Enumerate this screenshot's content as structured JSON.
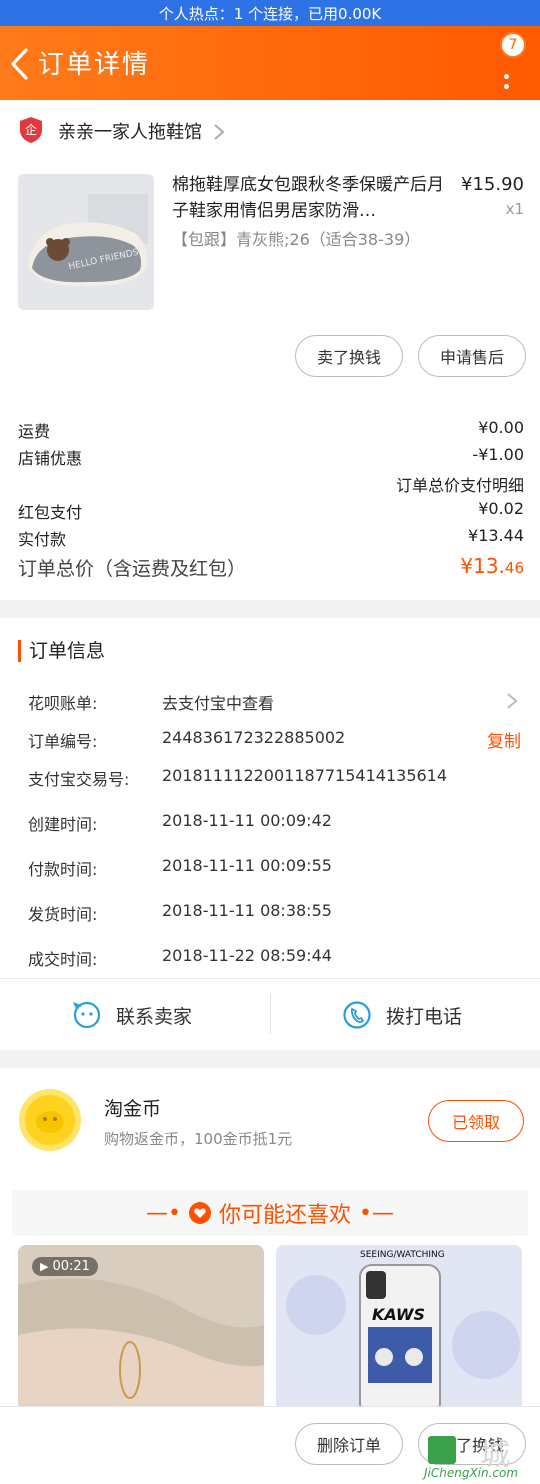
{
  "status_bar": {
    "hotspot_text": "个人热点：1 个连接，已用0.00K"
  },
  "header": {
    "title": "订单详情",
    "badge_count": "7"
  },
  "shop": {
    "name": "亲亲一家人拖鞋馆"
  },
  "product": {
    "title": "棉拖鞋厚底女包跟秋冬季保暖产后月子鞋家用情侣男居家防滑…",
    "sku": "【包跟】青灰熊;26（适合38-39）",
    "price": "¥15.90",
    "qty": "x1",
    "image_text": "HELLO FRIENDS"
  },
  "actions": {
    "sell_label": "卖了换钱",
    "after_sale_label": "申请售后"
  },
  "fees": {
    "shipping_label": "运费",
    "shipping_value": "¥0.00",
    "discount_label": "店铺优惠",
    "discount_value": "-¥1.00",
    "detail_link": "订单总价支付明细",
    "redpacket_label": "红包支付",
    "redpacket_value": "¥0.02",
    "paid_label": "实付款",
    "paid_value": "¥13.44",
    "total_label": "订单总价（含运费及红包）",
    "total_big": "¥13.",
    "total_small": "46"
  },
  "order_info": {
    "title": "订单信息",
    "huabei_label": "花呗账单:",
    "huabei_value": "去支付宝中查看",
    "order_no_label": "订单编号:",
    "order_no_value": "244836172322885002",
    "copy_label": "复制",
    "alipay_label": "支付宝交易号:",
    "alipay_value": "2018111122001187715414135614",
    "created_label": "创建时间:",
    "created_value": "2018-11-11 00:09:42",
    "paid_label": "付款时间:",
    "paid_value": "2018-11-11 00:09:55",
    "shipped_label": "发货时间:",
    "shipped_value": "2018-11-11 08:38:55",
    "done_label": "成交时间:",
    "done_value": "2018-11-22 08:59:44"
  },
  "contact": {
    "seller_label": "联系卖家",
    "phone_label": "拨打电话"
  },
  "coins": {
    "title": "淘金币",
    "subtitle": "购物返金币，100金币抵1元",
    "button": "已领取"
  },
  "recommend": {
    "title": "你可能还喜欢",
    "item1_duration": "00:21",
    "item2_brand": "SEEING/WATCHING",
    "item2_logo": "KAWS"
  },
  "bottom": {
    "delete_label": "删除订单",
    "sell_label": "卖了换钱",
    "watermark_cn": "城",
    "watermark_site": "JiChengXin.com"
  },
  "colors": {
    "accent": "#ff5000",
    "hotspot_bar": "#2d73e6",
    "header_start": "#ff7a1a",
    "header_end": "#ff5a00"
  }
}
